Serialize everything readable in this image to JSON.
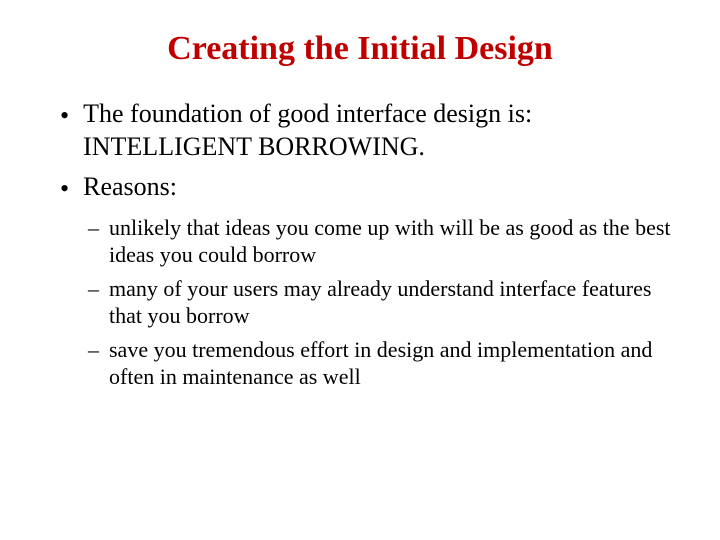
{
  "title": "Creating the Initial Design",
  "bullets": [
    {
      "marker": "•",
      "text": "The foundation of good interface design is: INTELLIGENT BORROWING."
    },
    {
      "marker": "•",
      "text": "Reasons:"
    }
  ],
  "subbullets": [
    {
      "marker": "–",
      "text": "unlikely that ideas you come up with will be as good as the best ideas you could borrow"
    },
    {
      "marker": "–",
      "text": " many of your users may already understand interface features that you borrow"
    },
    {
      "marker": "–",
      "text": "save you tremendous effort in design and implementation and often in maintenance as well"
    }
  ]
}
